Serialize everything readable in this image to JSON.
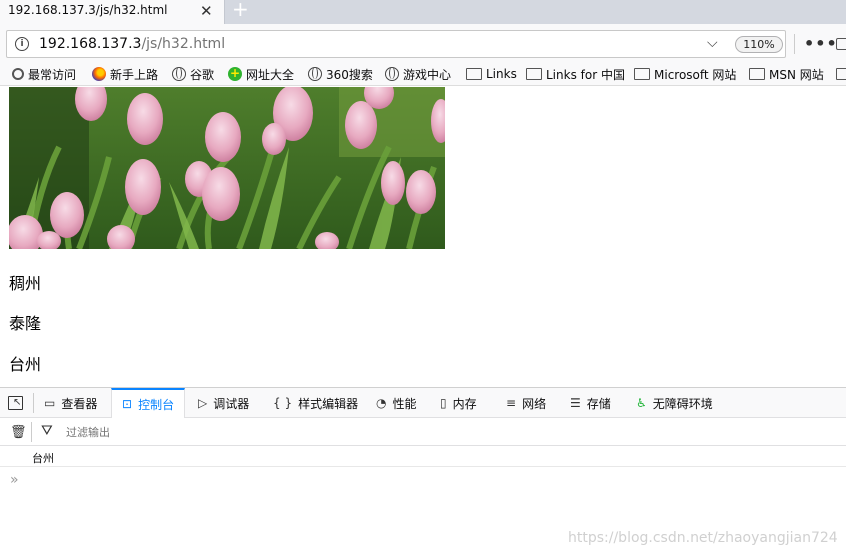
{
  "tab": {
    "title": "192.168.137.3/js/h32.html",
    "close": "✕",
    "new_tab": "+"
  },
  "urlbar": {
    "host": "192.168.137.3",
    "path": "/js/h32.html",
    "zoom": "110%"
  },
  "bookmarks": [
    {
      "label": "最常访问",
      "icon": "gear-icon"
    },
    {
      "label": "新手上路",
      "icon": "firefox-icon"
    },
    {
      "label": "谷歌",
      "icon": "globe-icon"
    },
    {
      "label": "网址大全",
      "icon": "plus-circle-icon"
    },
    {
      "label": "360搜索",
      "icon": "globe-icon"
    },
    {
      "label": "游戏中心",
      "icon": "globe-icon"
    },
    {
      "label": "Links",
      "icon": "folder-icon"
    },
    {
      "label": "Links for 中国",
      "icon": "folder-icon"
    },
    {
      "label": "Microsoft 网站",
      "icon": "folder-icon"
    },
    {
      "label": "MSN 网站",
      "icon": "folder-icon"
    }
  ],
  "content": {
    "cities": [
      "稠州",
      "泰隆",
      "台州"
    ]
  },
  "devtools": {
    "tabs": [
      {
        "label": "查看器",
        "icon": "inspector-icon"
      },
      {
        "label": "控制台",
        "icon": "console-icon",
        "selected": true
      },
      {
        "label": "调试器",
        "icon": "debugger-icon"
      },
      {
        "label": "样式编辑器",
        "icon": "style-editor-icon"
      },
      {
        "label": "性能",
        "icon": "performance-icon"
      },
      {
        "label": "内存",
        "icon": "memory-icon"
      },
      {
        "label": "网络",
        "icon": "network-icon"
      },
      {
        "label": "存储",
        "icon": "storage-icon"
      },
      {
        "label": "无障碍环境",
        "icon": "accessibility-icon"
      }
    ],
    "filter_placeholder": "过滤输出",
    "console_output": "台州",
    "prompt": "»"
  },
  "watermark": "https://blog.csdn.net/zhaoyangjian724"
}
